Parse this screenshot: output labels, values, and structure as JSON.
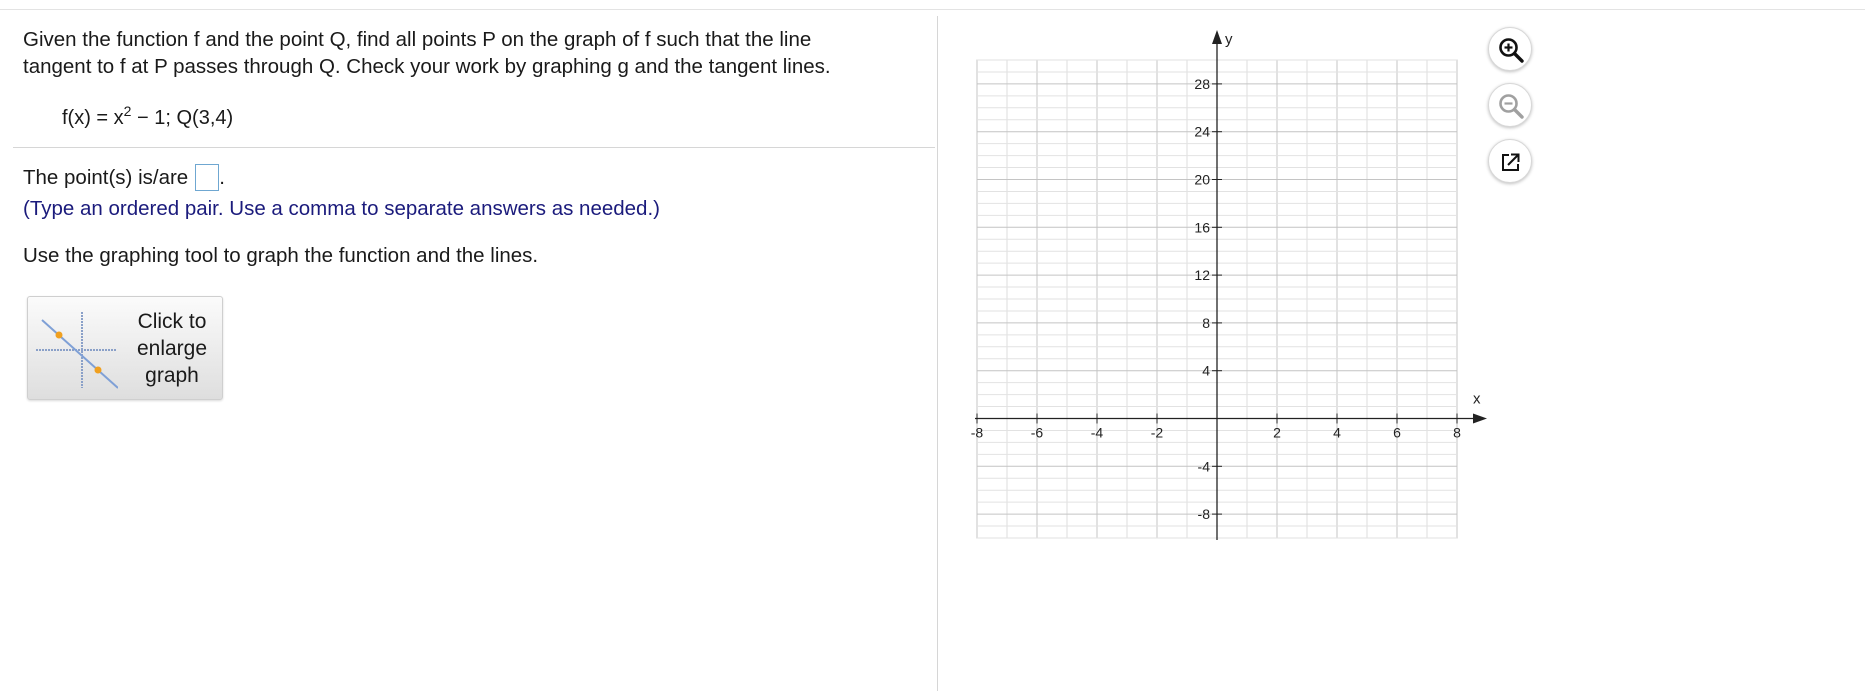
{
  "question": {
    "line1": "Given the function f and the point Q, find all points P on the graph of f such that the line",
    "line2": "tangent to f at P passes through Q. Check your work by graphing g and the tangent lines.",
    "formula_base": "f(x) = x",
    "formula_exp": "2",
    "formula_rest": " − 1; Q(3,4)"
  },
  "answer": {
    "label": "The point(s) is/are",
    "value": "",
    "suffix": ".",
    "hint": "(Type an ordered pair. Use a comma to separate answers as needed.)"
  },
  "instruction": "Use the graphing tool to graph the function and the lines.",
  "enlarge_button": {
    "label": "Click to\nenlarge\ngraph"
  },
  "graph": {
    "x_label": "x",
    "y_label": "y",
    "x_ticks": [
      "-8",
      "-6",
      "-4",
      "-2",
      "2",
      "4",
      "6",
      "8"
    ],
    "y_ticks": [
      "28",
      "24",
      "20",
      "16",
      "12",
      "8",
      "4",
      "-4",
      "-8"
    ],
    "x_range": [
      -8,
      8
    ],
    "y_range": [
      -10,
      30
    ]
  },
  "tools": {
    "zoom_in": "zoom-in",
    "zoom_out": "zoom-out",
    "popout": "popout"
  }
}
